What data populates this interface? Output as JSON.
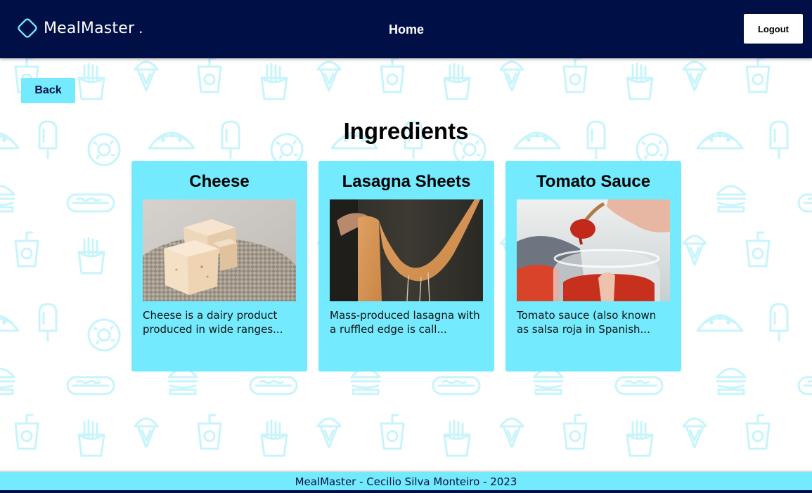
{
  "header": {
    "brand_name": "MealMaster",
    "brand_dot": ".",
    "nav_home": "Home",
    "logout_label": "Logout"
  },
  "back_label": "Back",
  "page_title": "Ingredients",
  "cards": [
    {
      "title": "Cheese",
      "description": "Cheese is a dairy product produced in wide ranges...",
      "image_subject": "cheese-photo"
    },
    {
      "title": "Lasagna Sheets",
      "description": "Mass-produced lasagna with a ruffled edge is call...",
      "image_subject": "lasagna-sheets-photo"
    },
    {
      "title": "Tomato Sauce",
      "description": "Tomato sauce (also known as salsa roja in Spanish...",
      "image_subject": "tomato-sauce-photo"
    }
  ],
  "footer": {
    "text": "MealMaster - Cecilio Silva Monteiro - 2023"
  },
  "colors": {
    "header_bg": "#000f45",
    "accent": "#74eafe",
    "pattern": "#c8f4fb"
  }
}
